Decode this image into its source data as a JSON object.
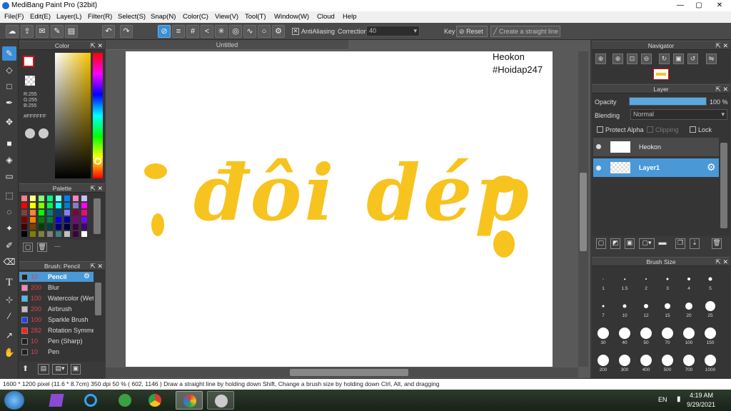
{
  "window": {
    "title": "MediBang Paint Pro (32bit)",
    "minimize": "—",
    "maximize": "▢",
    "close": "✕"
  },
  "menu": [
    "File(F)",
    "Edit(E)",
    "Layer(L)",
    "Filter(R)",
    "Select(S)",
    "Snap(N)",
    "Color(C)",
    "View(V)",
    "Tool(T)",
    "Window(W)",
    "Cloud",
    "Help"
  ],
  "toolbar": {
    "antialiasing_label": "AntiAliasing",
    "correction_label": "Correction",
    "correction_value": "40",
    "key_label": "Key",
    "reset_label": "Reset",
    "straight_line_label": "Create a straight line"
  },
  "color_panel": {
    "title": "Color",
    "r": "R:255",
    "g": "G:255",
    "b": "B:255",
    "hex": "#FFFFFF",
    "fg_color": "#ffffff",
    "bg_color": "#000000"
  },
  "palette": {
    "title": "Palette",
    "dashes": "---",
    "colors": [
      "#ff8080",
      "#ffff80",
      "#80ff80",
      "#00ff80",
      "#80ffff",
      "#0080ff",
      "#ff80c0",
      "#c0c0ff",
      "#ff0000",
      "#ffff00",
      "#80ff00",
      "#00ff40",
      "#00ffff",
      "#0080c0",
      "#8080c0",
      "#ff00ff",
      "#804040",
      "#ff8040",
      "#00ff00",
      "#008080",
      "#004080",
      "#8080ff",
      "#800040",
      "#ff0080",
      "#800000",
      "#ff8000",
      "#008000",
      "#008040",
      "#0000ff",
      "#0000a0",
      "#800080",
      "#8000ff",
      "#400000",
      "#804000",
      "#004000",
      "#004040",
      "#000080",
      "#000040",
      "#400040",
      "#400080",
      "#000000",
      "#808000",
      "#808040",
      "#808080",
      "#408080",
      "#c0c0c0",
      "#400040",
      "#ffffff"
    ]
  },
  "brush_panel": {
    "title": "Brush: Pencil",
    "brushes": [
      {
        "size": "10",
        "name": "Pencil",
        "color": "#202020",
        "selected": true
      },
      {
        "size": "200",
        "name": "Blur",
        "color": "#ff80c0"
      },
      {
        "size": "100",
        "name": "Watercolor (Wet)",
        "color": "#40c0ff"
      },
      {
        "size": "200",
        "name": "Airbrush",
        "color": "#c0c0c0"
      },
      {
        "size": "100",
        "name": "Sparkle Brush",
        "color": "#2040ff"
      },
      {
        "size": "282",
        "name": "Rotation Symmetry",
        "color": "#ff2020"
      },
      {
        "size": "10",
        "name": "Pen (Sharp)",
        "color": "#202020"
      },
      {
        "size": "10",
        "name": "Pen",
        "color": "#202020"
      }
    ]
  },
  "document": {
    "tab_title": "Untitled",
    "text_line1": "Heokon",
    "text_line2": "#Hoidap247",
    "lettering": "đôi dép"
  },
  "navigator": {
    "title": "Navigator"
  },
  "layer_panel": {
    "title": "Layer",
    "opacity_label": "Opacity",
    "opacity_value": "100 %",
    "opacity_fraction": 1.0,
    "blending_label": "Blending",
    "blending_value": "Normal",
    "protect_alpha": "Protect Alpha",
    "clipping": "Clipping",
    "lock": "Lock",
    "layers": [
      {
        "name": "Heokon",
        "selected": false
      },
      {
        "name": "Layer1",
        "selected": true
      }
    ]
  },
  "brush_size_panel": {
    "title": "Brush Size",
    "sizes": [
      "1",
      "1.5",
      "2",
      "3",
      "4",
      "5",
      "7",
      "10",
      "12",
      "15",
      "20",
      "25",
      "30",
      "40",
      "50",
      "70",
      "100",
      "150",
      "200",
      "300",
      "400",
      "500",
      "700",
      "1000"
    ]
  },
  "statusbar": {
    "text": "1600 * 1200 pixel   (11.6 * 8.7cm)   350 dpi   50 %   ( 602, 1146 )   Draw a straight line by holding down Shift, Change a brush size by holding down Ctrl, Alt, and dragging"
  },
  "taskbar": {
    "lang": "EN",
    "time": "4:19 AM",
    "date": "9/29/2021"
  }
}
